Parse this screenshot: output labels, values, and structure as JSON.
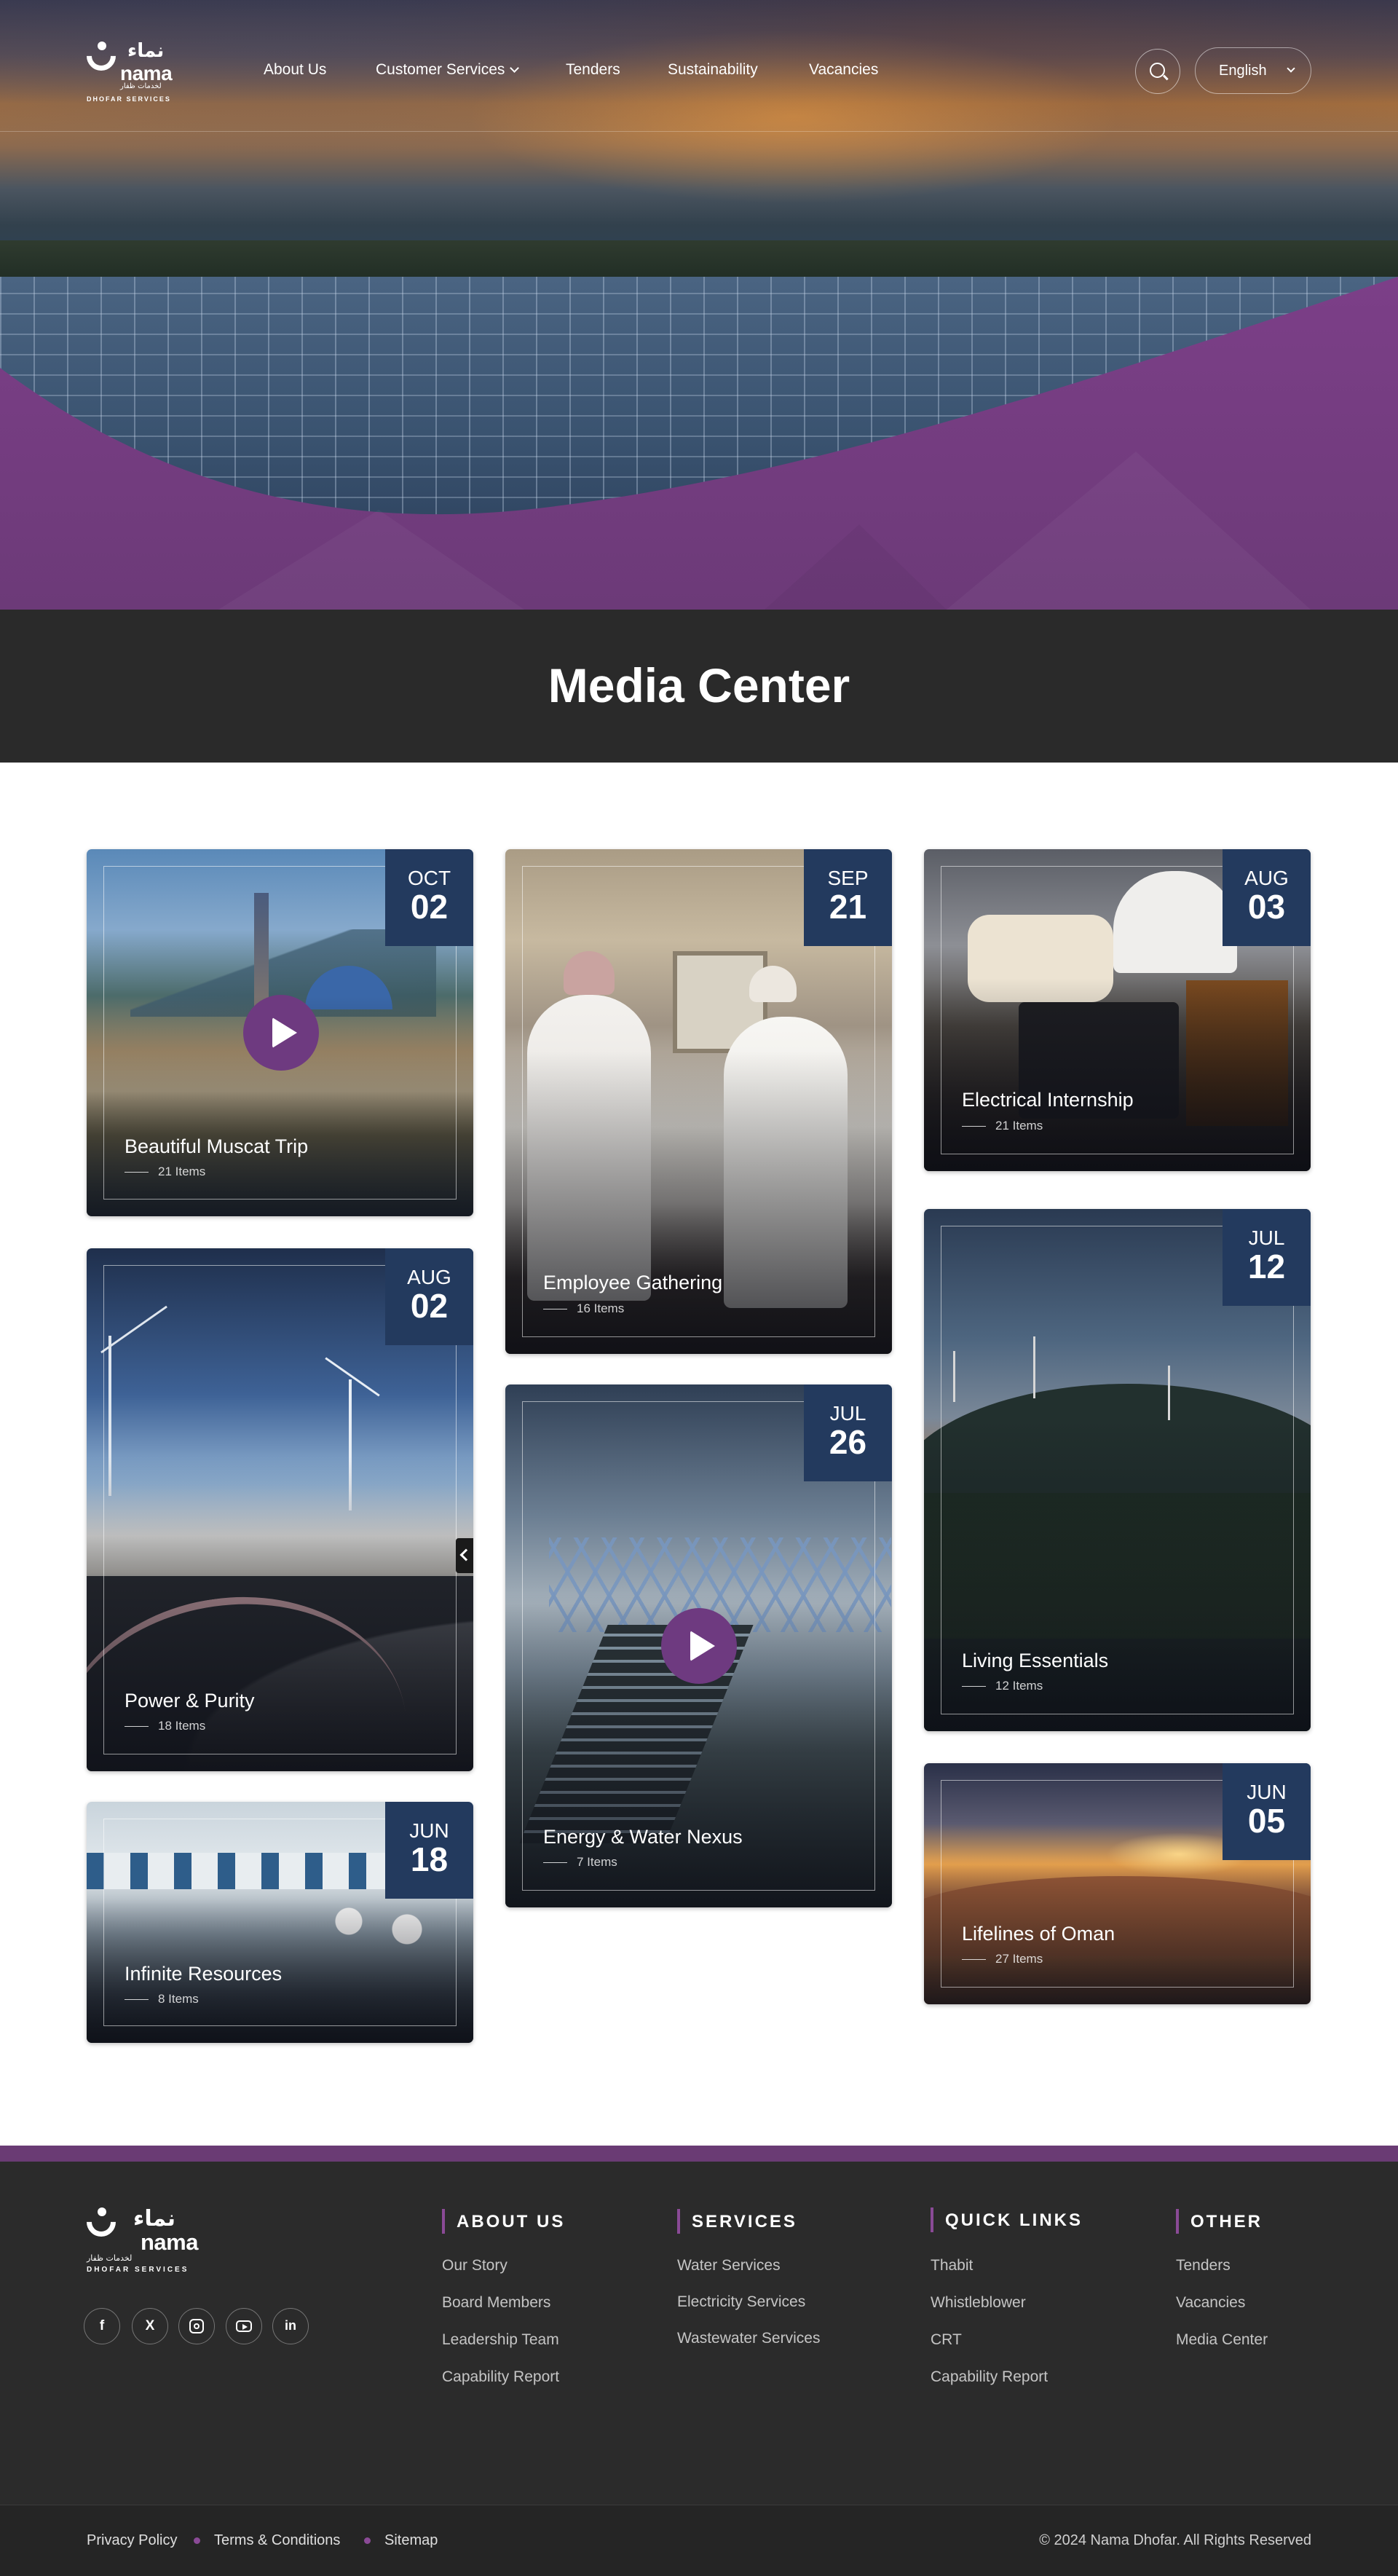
{
  "brand": {
    "logo_arabic": "نماء",
    "logo_latin": "nama",
    "logo_sub_arabic": "لخدمات ظفار",
    "logo_sub": "DHOFAR SERVICES"
  },
  "nav": {
    "items": [
      "About Us",
      "Customer Services",
      "Tenders",
      "Sustainability",
      "Vacancies"
    ],
    "language": "English"
  },
  "page": {
    "title": "Media Center"
  },
  "gallery": [
    {
      "title": "Beautiful Muscat Trip",
      "count": "21 Items",
      "month": "OCT",
      "day": "02",
      "video": true
    },
    {
      "title": "Power & Purity",
      "count": "18 Items",
      "month": "AUG",
      "day": "02",
      "video": false
    },
    {
      "title": "Infinite Resources",
      "count": "8 Items",
      "month": "JUN",
      "day": "18",
      "video": false
    },
    {
      "title": "Employee Gathering",
      "count": "16 Items",
      "month": "SEP",
      "day": "21",
      "video": false
    },
    {
      "title": "Energy & Water Nexus",
      "count": "7 Items",
      "month": "JUL",
      "day": "26",
      "video": true
    },
    {
      "title": "Electrical Internship",
      "count": "21 Items",
      "month": "AUG",
      "day": "03",
      "video": false
    },
    {
      "title": "Living Essentials",
      "count": "12 Items",
      "month": "JUL",
      "day": "12",
      "video": false
    },
    {
      "title": "Lifelines of Oman",
      "count": "27 Items",
      "month": "JUN",
      "day": "05",
      "video": false
    }
  ],
  "footer": {
    "social": [
      "facebook-icon",
      "x-icon",
      "instagram-icon",
      "youtube-icon",
      "linkedin-icon"
    ],
    "columns": [
      {
        "title": "ABOUT US",
        "links": [
          "Our Story",
          "Board Members",
          "Leadership Team",
          "Capability Report"
        ]
      },
      {
        "title": "SERVICES",
        "links": [
          "Water Services",
          "Electricity Services",
          "Wastewater Services"
        ]
      },
      {
        "title": "QUICK LINKS",
        "links": [
          "Thabit",
          "Whistleblower",
          "CRT",
          "Capability Report"
        ]
      },
      {
        "title": "OTHER",
        "links": [
          "Tenders",
          "Vacancies",
          "Media Center"
        ]
      }
    ],
    "bottom_links": [
      "Privacy Policy",
      "Terms & Conditions",
      "Sitemap"
    ],
    "copyright": "© 2024 Nama Dhofar. All Rights Reserved"
  },
  "colors": {
    "accent_purple": "#6a3b74",
    "date_badge": "#233a5e",
    "dark_bar": "#2a2a2a"
  }
}
